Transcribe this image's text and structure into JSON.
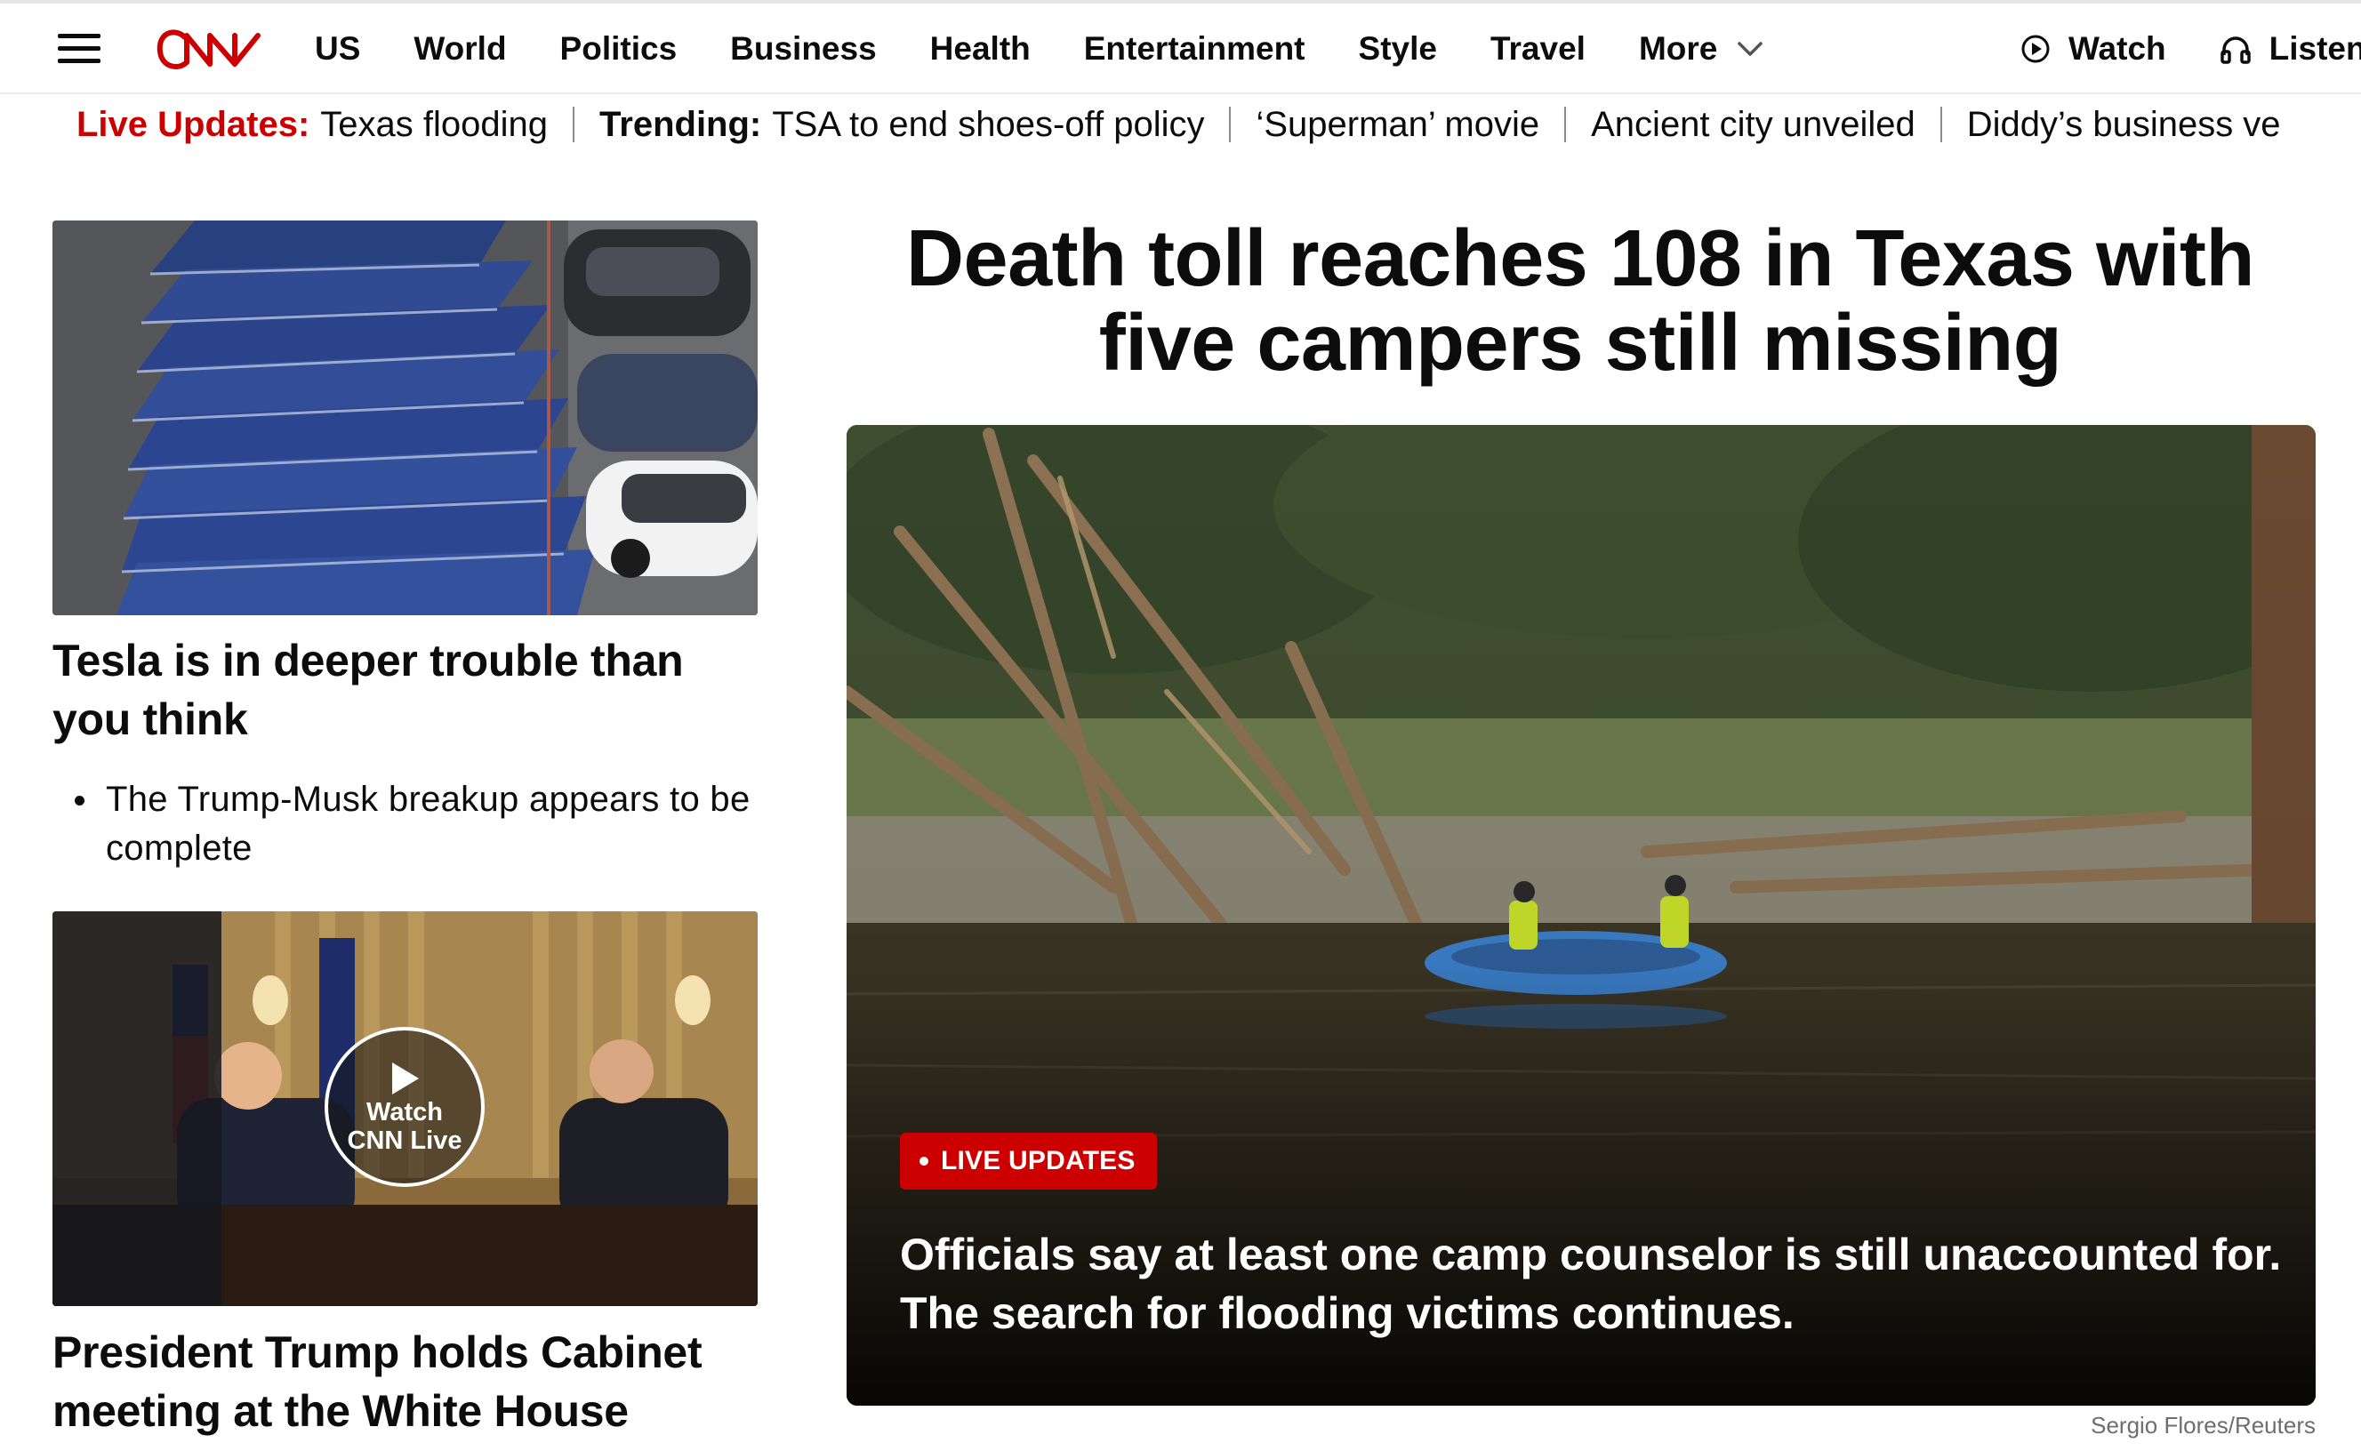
{
  "header": {
    "nav": [
      "US",
      "World",
      "Politics",
      "Business",
      "Health",
      "Entertainment",
      "Style",
      "Travel",
      "More"
    ],
    "right": {
      "watch": "Watch",
      "listen": "Listen"
    },
    "logo_text": "CNN"
  },
  "trending": {
    "live_label": "Live Updates:",
    "live_text": "Texas flooding",
    "trending_label": "Trending:",
    "items": [
      "TSA to end shoes-off policy",
      "‘Superman’ movie",
      "Ancient city unveiled",
      "Diddy’s business ve"
    ]
  },
  "left": {
    "story1": {
      "title": "Tesla is in deeper trouble than you think",
      "bullet": "The Trump-Musk breakup appears to be complete"
    },
    "story2": {
      "watch_line1": "Watch",
      "watch_line2": "CNN Live",
      "title": "President Trump holds Cabinet meeting at the White House"
    }
  },
  "main": {
    "headline": "Death toll reaches 108 in Texas with five campers still missing",
    "badge": "LIVE UPDATES",
    "subhead": "Officials say at least one camp counselor is still unaccounted for. The search for flooding victims continues.",
    "credit": "Sergio Flores/Reuters"
  },
  "colors": {
    "brand_red": "#cc0000",
    "text": "#0c0c0c",
    "credit_gray": "#6e6e6e"
  },
  "icons": [
    "hamburger-menu-icon",
    "cnn-logo",
    "chevron-down-icon",
    "play-circle-icon",
    "headphones-icon",
    "play-icon"
  ]
}
